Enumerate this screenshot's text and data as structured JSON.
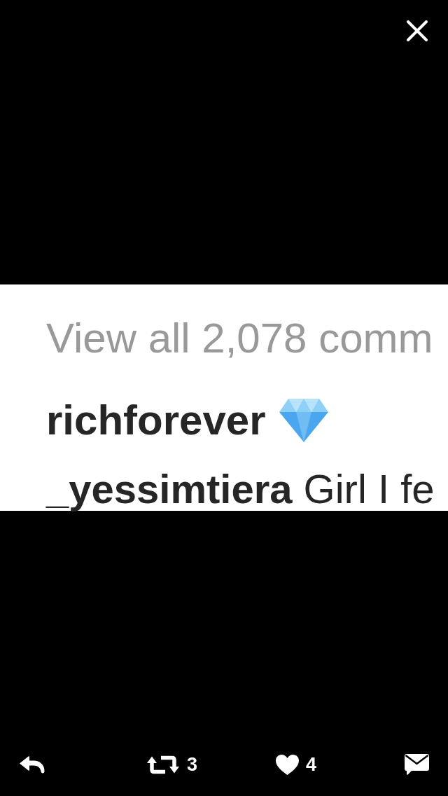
{
  "screenshot": {
    "lines": [
      {
        "kind": "view_all",
        "text": "View all 2,078 comm"
      },
      {
        "kind": "caption",
        "username": "richforever"
      },
      {
        "kind": "comment",
        "text": "**_yessimtiera** Girl I fe"
      }
    ]
  },
  "actions": [
    {
      "kind": "reply"
    },
    {
      "kind": "retweet",
      "count": "3"
    },
    {
      "kind": "like",
      "count": "4"
    },
    {
      "kind": "message"
    }
  ]
}
